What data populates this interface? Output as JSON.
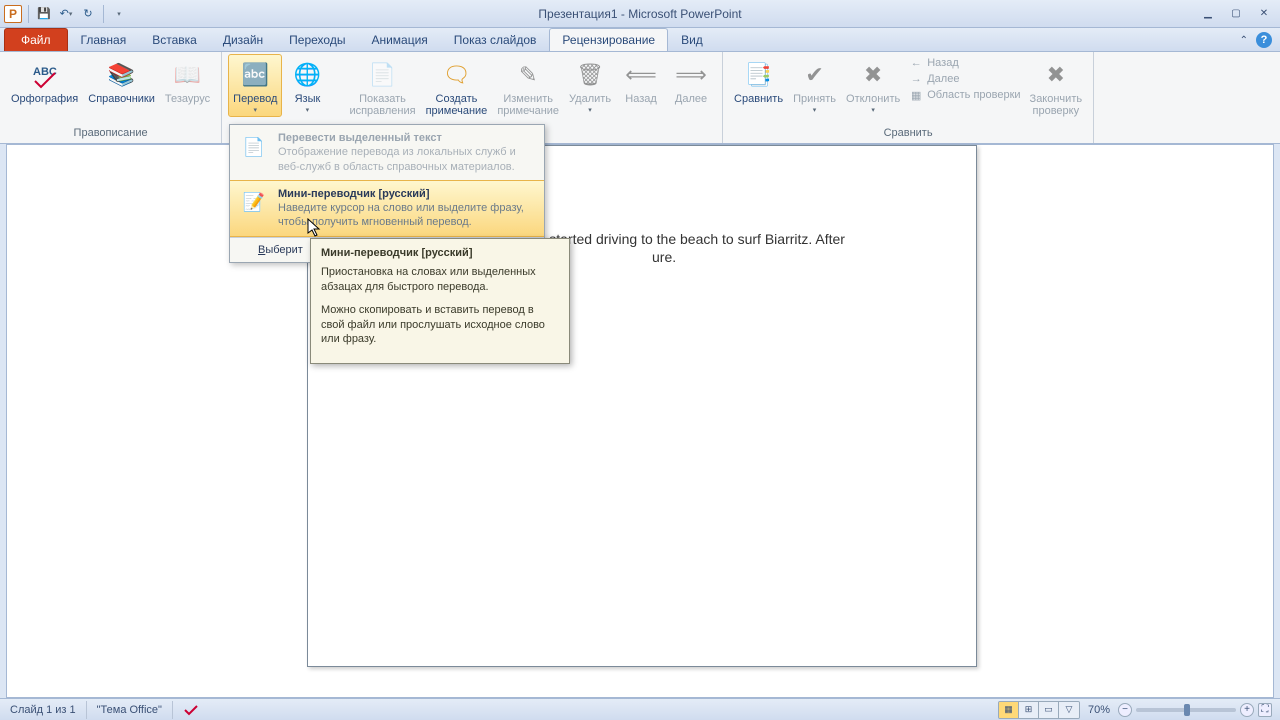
{
  "title": "Презентация1  -  Microsoft PowerPoint",
  "tabs": {
    "file": "Файл",
    "items": [
      "Главная",
      "Вставка",
      "Дизайн",
      "Переходы",
      "Анимация",
      "Показ слайдов",
      "Рецензирование",
      "Вид"
    ],
    "active_index": 6
  },
  "ribbon": {
    "groups": {
      "proofing": {
        "label": "Правописание",
        "spelling": "Орфография",
        "research": "Справочники",
        "thesaurus": "Тезаурус"
      },
      "language": {
        "translate": "Перевод",
        "language": "Язык"
      },
      "comments": {
        "show": "Показать\nисправления",
        "new": "Создать\nпримечание",
        "edit": "Изменить\nпримечание",
        "delete": "Удалить",
        "prev": "Назад",
        "next": "Далее"
      },
      "compare": {
        "label": "Сравнить",
        "compare": "Сравнить",
        "accept": "Принять",
        "reject": "Отклонить",
        "small": {
          "back": "Назад",
          "fwd": "Далее",
          "pane": "Область проверки"
        },
        "end": "Закончить\nпроверку"
      }
    }
  },
  "dropdown": {
    "item1": {
      "title": "Перевести выделенный текст",
      "desc": "Отображение перевода из локальных служб и веб-служб в область справочных материалов."
    },
    "item2": {
      "title": "Мини-переводчик [русский]",
      "desc": "Наведите курсор на слово или выделите фразу, чтобы получить мгновенный перевод."
    },
    "footer": "Выберит"
  },
  "tooltip": {
    "title": "Мини-переводчик [русский]",
    "p1": "Приостановка на словах или выделенных абзацах для быстрого перевода.",
    "p2": "Можно скопировать и вставить перевод в свой файл или прослушать исходное слово или фразу."
  },
  "slide_text": "est vacations. I started driving to the beach to surf Biarritz. After",
  "slide_text2": "ure.",
  "status": {
    "slide": "Слайд 1 из 1",
    "theme": "\"Тема Office\"",
    "zoom": "70%"
  }
}
